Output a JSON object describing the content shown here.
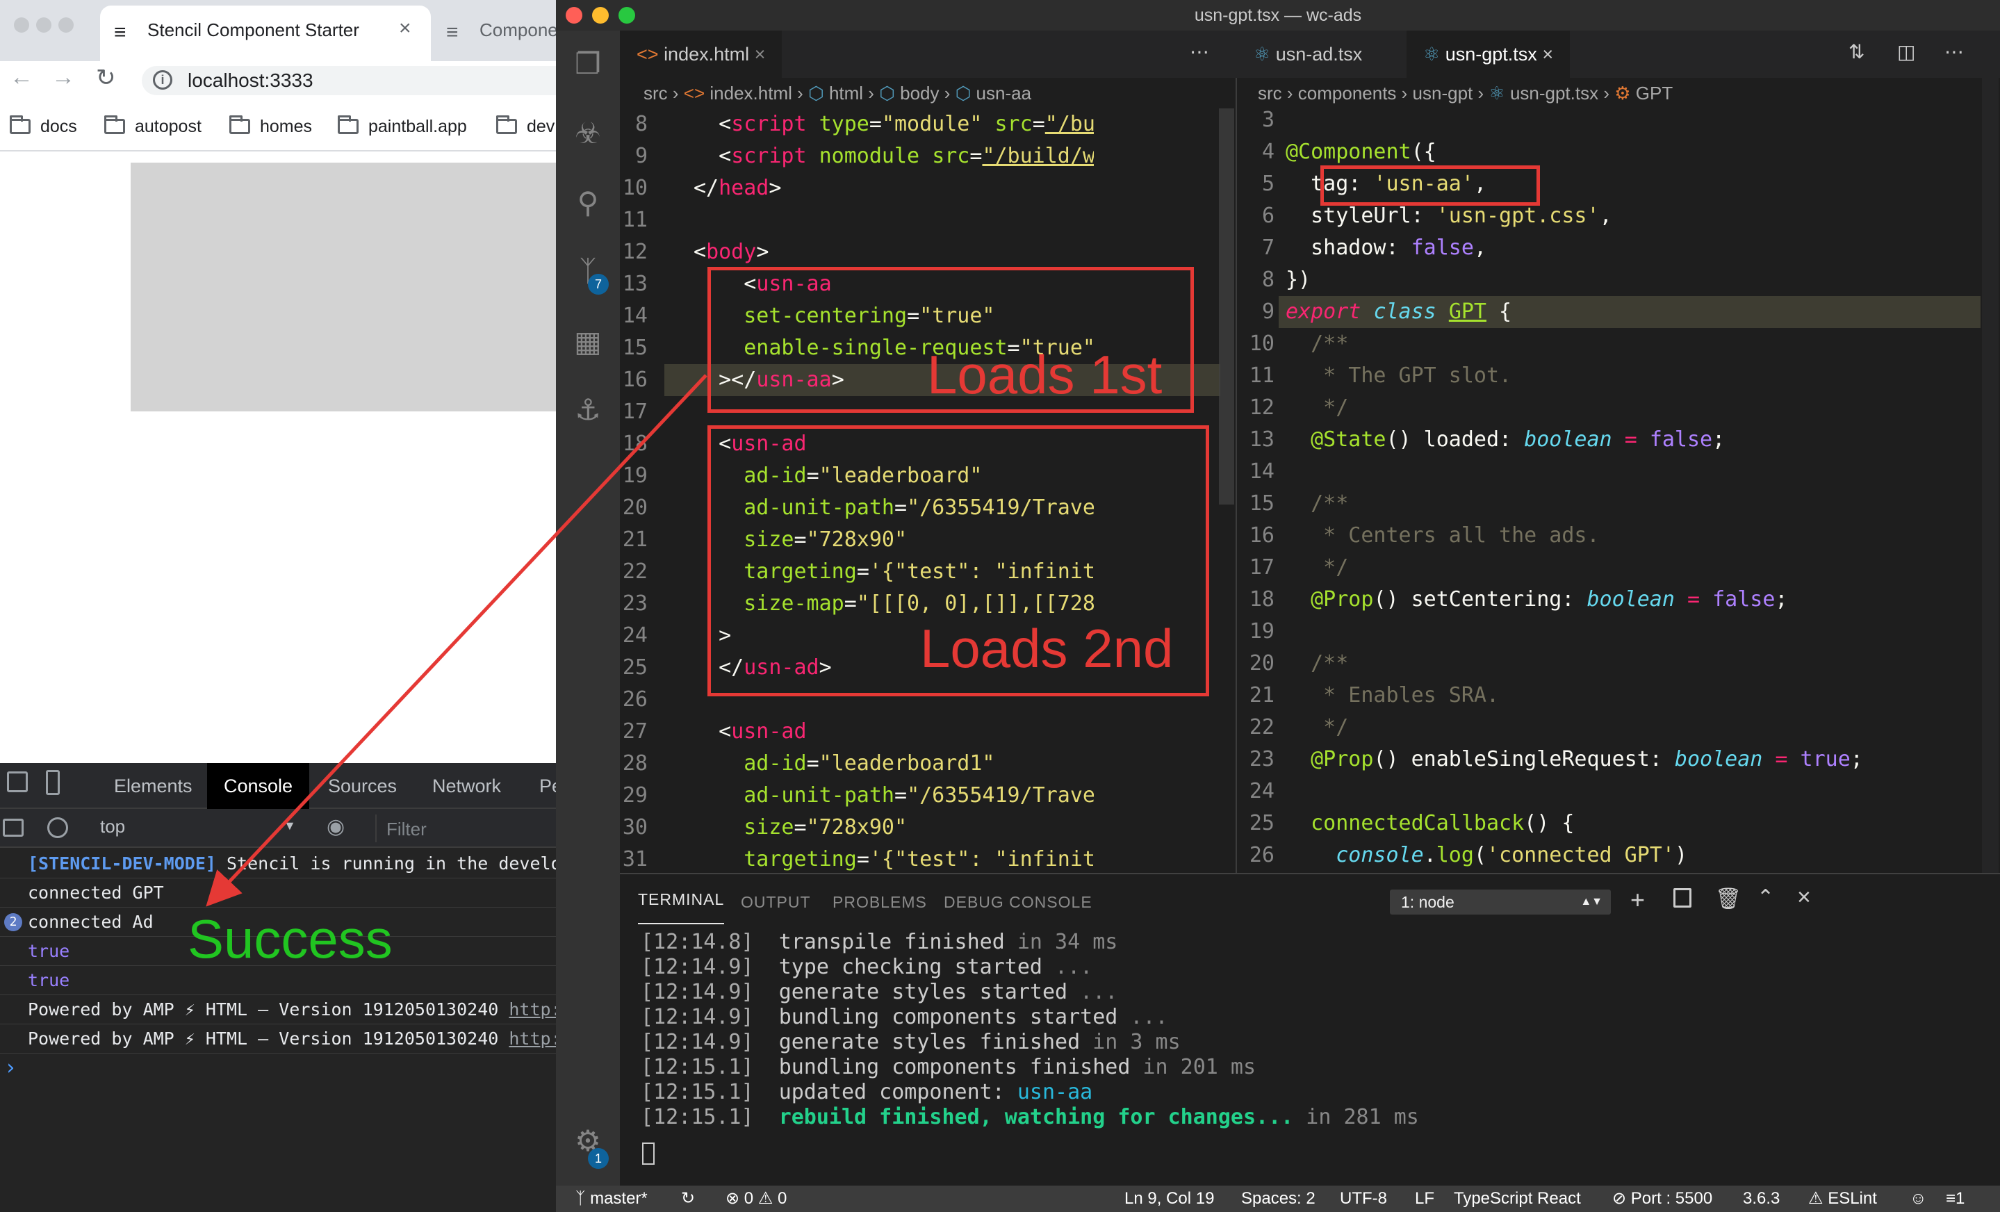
{
  "browser": {
    "tabs": [
      {
        "label": "Stencil Component Starter",
        "active": true
      },
      {
        "label": "Compone",
        "active": false
      }
    ],
    "url": "localhost:3333",
    "bookmarks": [
      "docs",
      "autopost",
      "homes",
      "paintball.app",
      "dev"
    ]
  },
  "devtools": {
    "tabs": [
      "Elements",
      "Console",
      "Sources",
      "Network",
      "Pe"
    ],
    "active_tab": "Console",
    "context": "top",
    "filter_placeholder": "Filter",
    "console": [
      {
        "prefix": "[STENCIL-DEV-MODE]",
        "text": " Stencil is running in the develop"
      },
      {
        "text": "connected GPT"
      },
      {
        "badge": "2",
        "text": "connected Ad"
      },
      {
        "text": "true"
      },
      {
        "text": "true"
      },
      {
        "text": "Powered by AMP ⚡ HTML – Version 1912050130240 ",
        "link": "http:/"
      },
      {
        "text": "Powered by AMP ⚡ HTML – Version 1912050130240 ",
        "link": "http:/"
      }
    ],
    "prompt": "›"
  },
  "vscode": {
    "title": "usn-gpt.tsx — wc-ads",
    "scm_badge": "7",
    "settings_badge": "1",
    "editor1": {
      "tab": "index.html",
      "breadcrumbs": [
        "src",
        "index.html",
        "html",
        "body",
        "usn-aa"
      ],
      "line_numbers": [
        "8",
        "9",
        "10",
        "11",
        "12",
        "13",
        "14",
        "15",
        "16",
        "17",
        "18",
        "19",
        "20",
        "21",
        "22",
        "23",
        "24",
        "25",
        "26",
        "27",
        "28",
        "29",
        "30",
        "31"
      ]
    },
    "editor2": {
      "tabs": [
        "usn-ad.tsx",
        "usn-gpt.tsx"
      ],
      "breadcrumbs": [
        "src",
        "components",
        "usn-gpt",
        "usn-gpt.tsx",
        "GPT"
      ],
      "line_numbers": [
        "3",
        "4",
        "5",
        "6",
        "7",
        "8",
        "9",
        "10",
        "11",
        "12",
        "13",
        "14",
        "15",
        "16",
        "17",
        "18",
        "19",
        "20",
        "21",
        "22",
        "23",
        "24",
        "25",
        "26"
      ]
    },
    "panel": {
      "tabs": [
        "TERMINAL",
        "OUTPUT",
        "PROBLEMS",
        "DEBUG CONSOLE"
      ],
      "terminal_select": "1: node",
      "lines": [
        {
          "time": "[12:14.8]",
          "msg": "transpile finished",
          "tail": " in 34 ms"
        },
        {
          "time": "[12:14.9]",
          "msg": "type checking started",
          "tail": " ..."
        },
        {
          "time": "[12:14.9]",
          "msg": "generate styles started",
          "tail": " ..."
        },
        {
          "time": "[12:14.9]",
          "msg": "bundling components started",
          "tail": " ..."
        },
        {
          "time": "[12:14.9]",
          "msg": "generate styles finished",
          "tail": " in 3 ms"
        },
        {
          "time": "[12:15.1]",
          "msg": "bundling components finished",
          "tail": " in 201 ms"
        },
        {
          "time": "[12:15.1]",
          "msg": "updated component: ",
          "tail": "usn-aa"
        },
        {
          "time": "[12:15.1]",
          "msg": "rebuild finished, watching for changes...",
          "tail": " in 281 ms"
        }
      ]
    },
    "status": {
      "branch": "master*",
      "errors": "0",
      "warnings": "0",
      "cursor": "Ln 9, Col 19",
      "spaces": "Spaces: 2",
      "encoding": "UTF-8",
      "eol": "LF",
      "language": "TypeScript React",
      "port": "Port : 5500",
      "version": "3.6.3",
      "eslint": "ESLint",
      "bell_count": "1"
    }
  },
  "annotations": {
    "loads_first": "Loads 1st",
    "loads_second": "Loads 2nd",
    "success": "Success"
  },
  "colors": {
    "annotation_red": "#e53935",
    "success_green": "#21c521",
    "statusbar": "#3c3c3c",
    "editor_bg": "#1e1e1e"
  }
}
